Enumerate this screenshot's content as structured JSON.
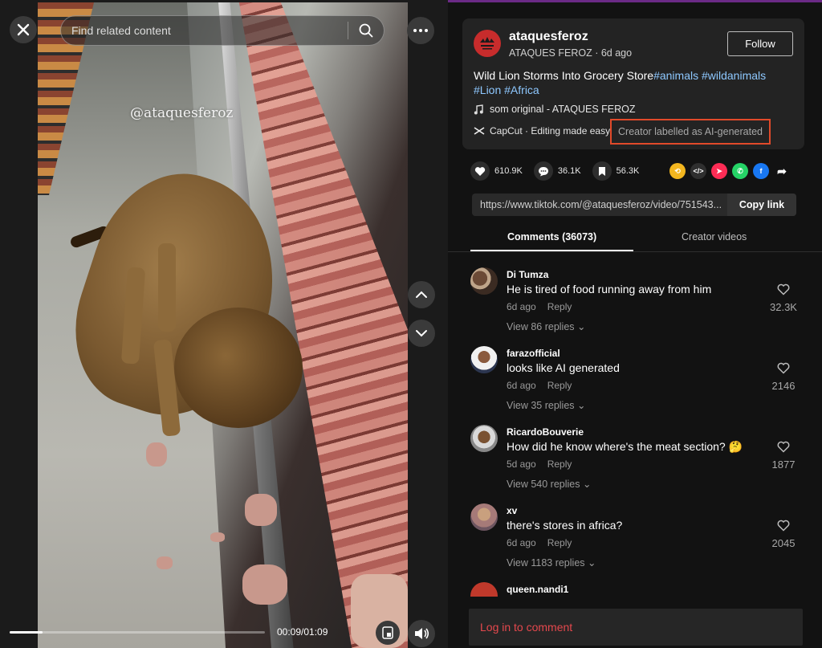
{
  "video": {
    "search_placeholder": "Find related content",
    "watermark": "@ataquesferoz",
    "time": "00:09/01:09",
    "progress_fraction": 0.13
  },
  "post": {
    "avatar_text": "ATAQUES FEROZ",
    "username": "ataquesferoz",
    "display_name": "ATAQUES FEROZ",
    "age": "6d ago",
    "follow_label": "Follow",
    "title": "Wild Lion Storms Into Grocery Store",
    "hashtags_line1": "#animals #wildanimals",
    "hashtags_line2": "#Lion #Africa",
    "sound": "som original - ATAQUES FEROZ",
    "capcut": "CapCut · Editing made easy",
    "ai_label": "Creator labelled as AI-generated"
  },
  "stats": {
    "likes": "610.9K",
    "comments": "36.1K",
    "saves": "56.3K"
  },
  "share": {
    "url": "https://www.tiktok.com/@ataquesferoz/video/751543...",
    "copy_label": "Copy link"
  },
  "tabs": {
    "comments": "Comments (36073)",
    "creator": "Creator videos"
  },
  "comments": [
    {
      "name": "Di Tumza",
      "text": "He is tired of food running away from him",
      "age": "6d ago",
      "reply": "Reply",
      "replies": "View 86 replies",
      "likes": "32.3K"
    },
    {
      "name": "farazofficial",
      "text": "looks like AI generated",
      "age": "6d ago",
      "reply": "Reply",
      "replies": "View 35 replies",
      "likes": "2146"
    },
    {
      "name": "RicardoBouverie",
      "text": "How did he know where's the meat section? 🤔",
      "age": "5d ago",
      "reply": "Reply",
      "replies": "View 540 replies",
      "likes": "1877"
    },
    {
      "name": "xv",
      "text": "there's stores in africa?",
      "age": "6d ago",
      "reply": "Reply",
      "replies": "View 1183 replies",
      "likes": "2045"
    },
    {
      "name": "queen.nandi1"
    }
  ],
  "login": {
    "label": "Log in to comment"
  },
  "colors": {
    "accent_red": "#e5484d",
    "hashtag_blue": "#8ec8ff",
    "ai_border": "#e14a2a"
  }
}
